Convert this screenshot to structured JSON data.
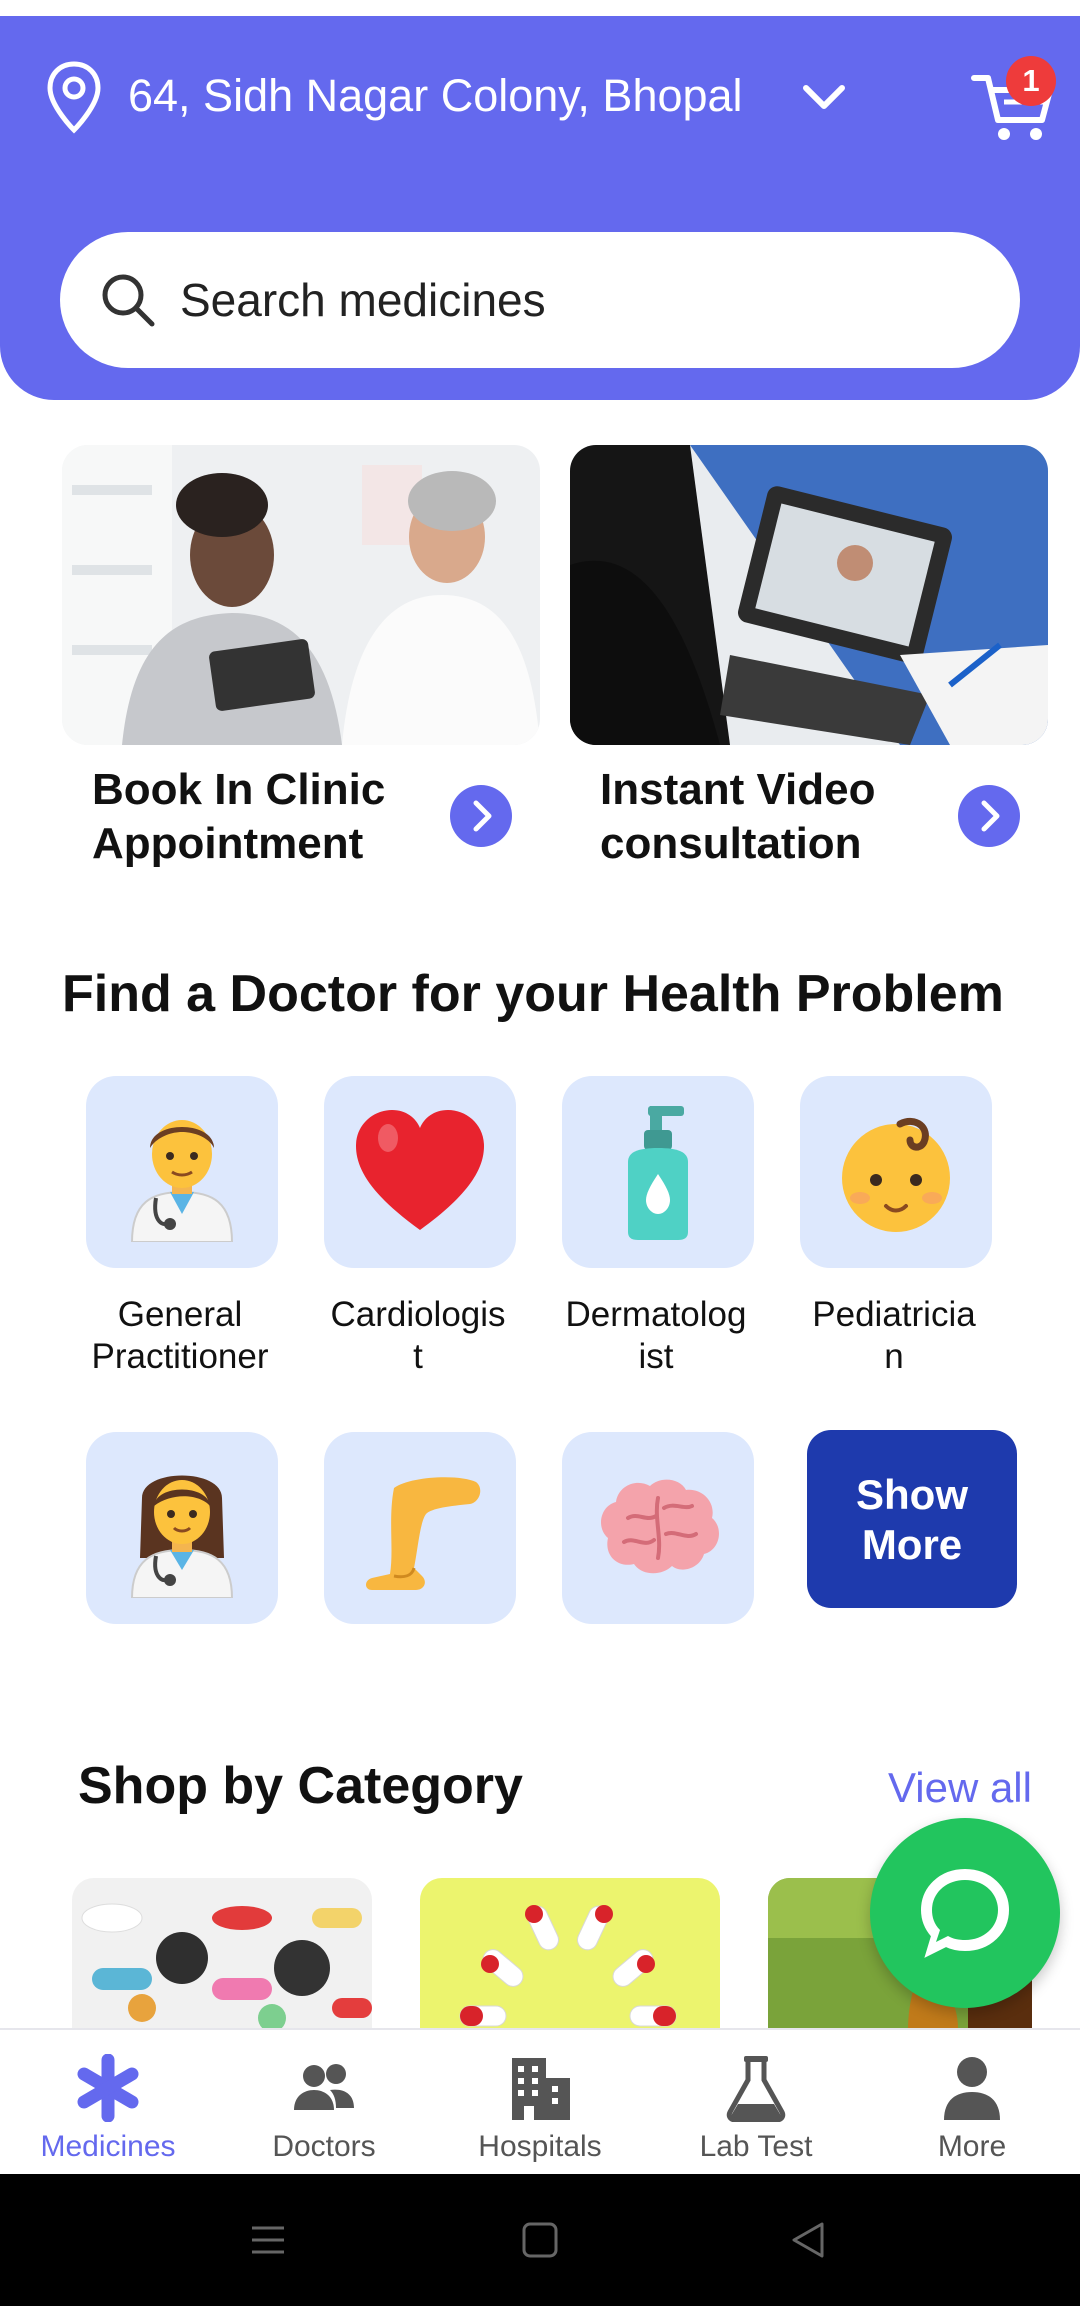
{
  "header": {
    "location": "64, Sidh Nagar Colony, Bhopal",
    "cart_count": "1",
    "bg_color": "#6469ee"
  },
  "search": {
    "placeholder": "Search medicines"
  },
  "banners": [
    {
      "title": "Book In Clinic Appointment",
      "icon": "chevron-right-icon"
    },
    {
      "title": "Instant Video consultation",
      "icon": "chevron-right-icon"
    }
  ],
  "doctor_section": {
    "title": "Find a Doctor for your Health Problem",
    "specialties": [
      {
        "label": "General\nPractitioner",
        "icon": "man-doctor-icon"
      },
      {
        "label": "Cardiologis\nt",
        "icon": "heart-icon"
      },
      {
        "label": "Dermatolog\nist",
        "icon": "lotion-bottle-icon"
      },
      {
        "label": "Pediatricia\nn",
        "icon": "baby-icon"
      },
      {
        "label": "",
        "icon": "woman-doctor-icon"
      },
      {
        "label": "",
        "icon": "leg-icon"
      },
      {
        "label": "",
        "icon": "brain-icon"
      }
    ],
    "show_more_label": "Show\nMore"
  },
  "shop_section": {
    "title": "Shop by Category",
    "view_all": "View all"
  },
  "bottom_nav": [
    {
      "label": "Medicines",
      "icon": "asterisk-icon",
      "active": true
    },
    {
      "label": "Doctors",
      "icon": "people-icon",
      "active": false
    },
    {
      "label": "Hospitals",
      "icon": "building-icon",
      "active": false
    },
    {
      "label": "Lab Test",
      "icon": "flask-icon",
      "active": false
    },
    {
      "label": "More",
      "icon": "person-icon",
      "active": false
    }
  ],
  "colors": {
    "accent": "#6469ee",
    "show_more_bg": "#1e3aad",
    "chat": "#22c55e",
    "badge": "#ee3b3b"
  }
}
